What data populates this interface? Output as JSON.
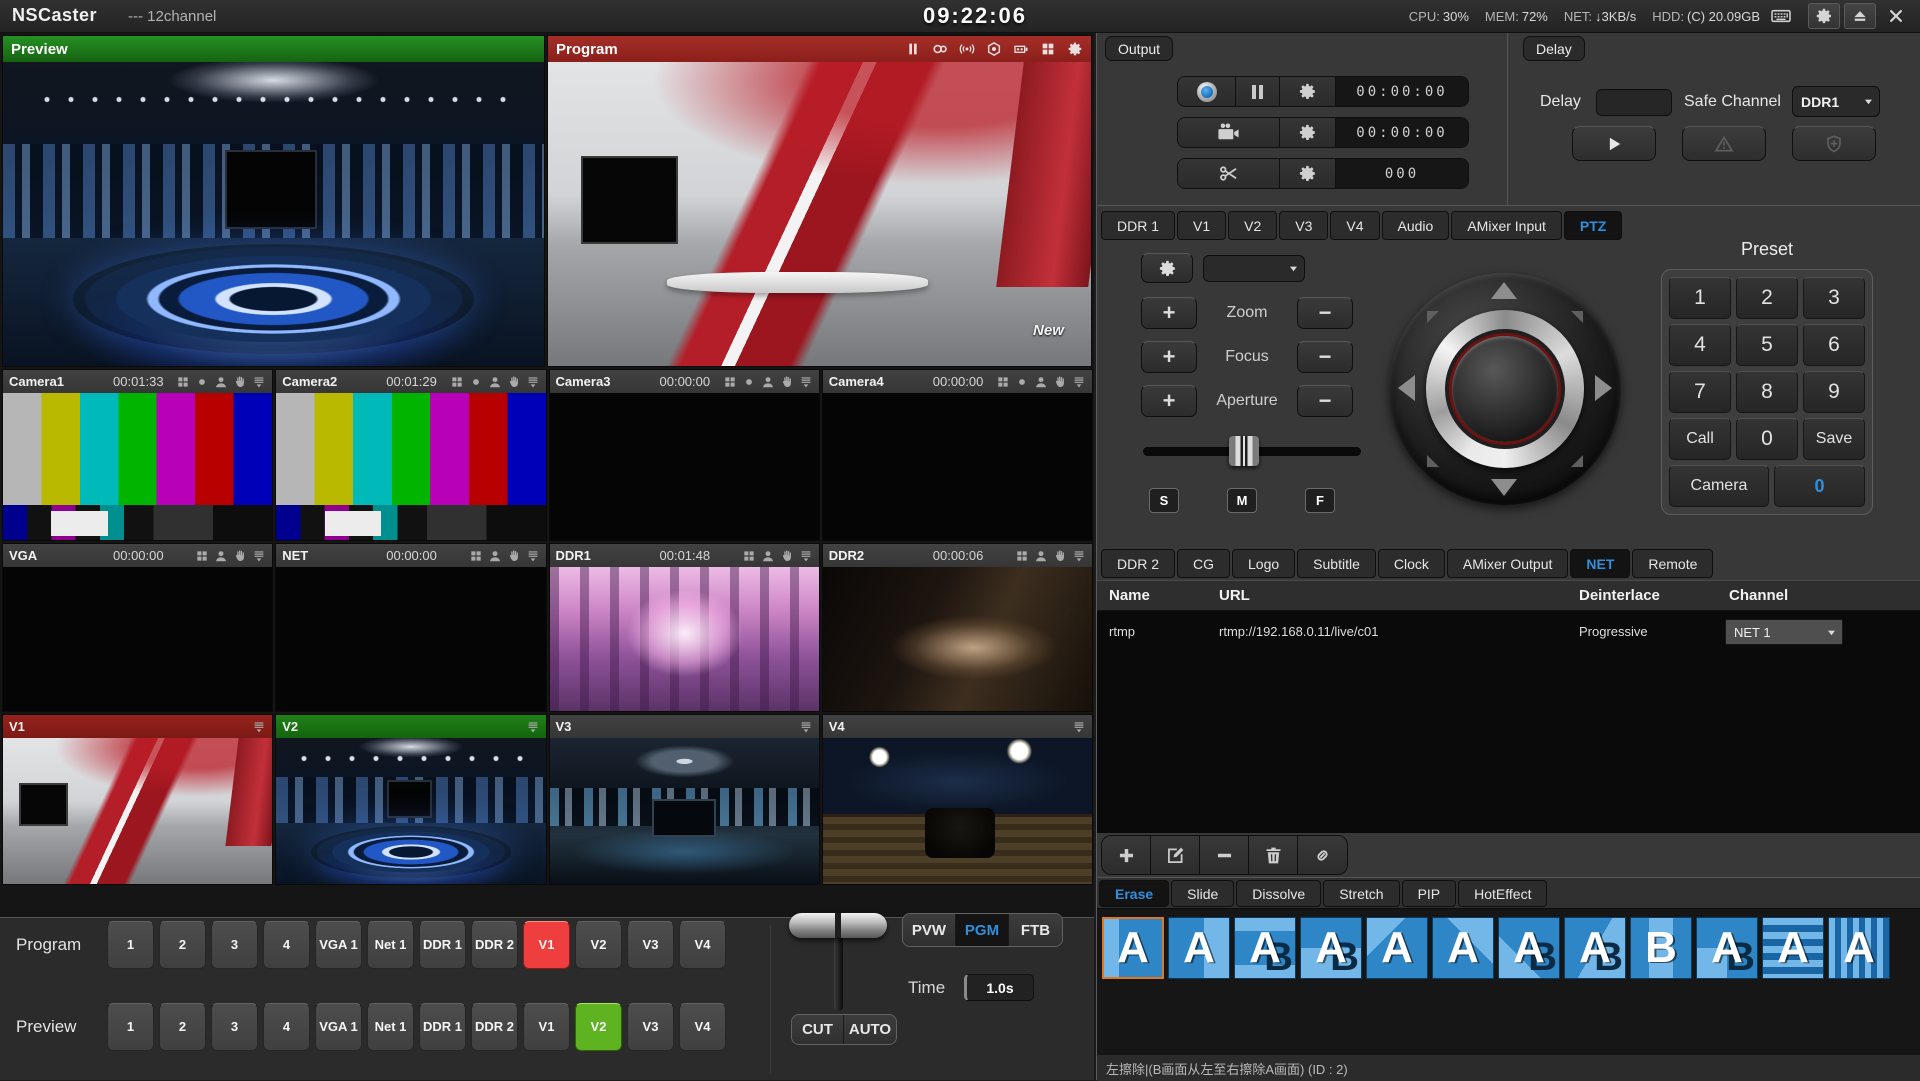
{
  "colors": {
    "accent_blue": "#2f8fde",
    "program_red": "#ee3e3e",
    "preview_green": "#5fb321",
    "tile_blue": "#2e86c6",
    "tile_light": "#72b7e8",
    "tile_selected_border": "#e0761f"
  },
  "titlebar": {
    "app_name": "NSCaster",
    "session": "--- 12channel",
    "clock": "09:22:06",
    "cpu_label": "CPU:",
    "cpu_value": "30%",
    "mem_label": "MEM:",
    "mem_value": "72%",
    "net_label": "NET:",
    "net_value": "↓3KB/s",
    "hdd_label": "HDD:",
    "hdd_value": "(C) 20.09GB",
    "icons": [
      "keyboard-icon",
      "settings-icon",
      "eject-icon",
      "close-icon"
    ]
  },
  "preview_pane": {
    "title": "Preview"
  },
  "program_pane": {
    "title": "Program",
    "watermark": "New",
    "icons": [
      "pause",
      "cc",
      "broadcast",
      "record",
      "capture",
      "grid",
      "gear"
    ]
  },
  "monitors": [
    {
      "name": "Camera1",
      "time": "00:01:33",
      "scene": "colorbars",
      "header": "default",
      "icons": [
        "grid",
        "dot",
        "person",
        "hand",
        "menu"
      ]
    },
    {
      "name": "Camera2",
      "time": "00:01:29",
      "scene": "colorbars",
      "header": "default",
      "icons": [
        "grid",
        "dot",
        "person",
        "hand",
        "menu"
      ]
    },
    {
      "name": "Camera3",
      "time": "00:00:00",
      "scene": "black",
      "header": "default",
      "icons": [
        "grid",
        "dot",
        "person",
        "hand",
        "menu"
      ]
    },
    {
      "name": "Camera4",
      "time": "00:00:00",
      "scene": "black",
      "header": "default",
      "icons": [
        "grid",
        "dot",
        "person",
        "hand",
        "menu"
      ]
    },
    {
      "name": "VGA",
      "time": "00:00:00",
      "scene": "black",
      "header": "default",
      "icons": [
        "grid",
        "person",
        "hand",
        "menu"
      ]
    },
    {
      "name": "NET",
      "time": "00:00:00",
      "scene": "black",
      "header": "default",
      "icons": [
        "grid",
        "person",
        "hand",
        "menu"
      ]
    },
    {
      "name": "DDR1",
      "time": "00:01:48",
      "scene": "forest",
      "header": "default",
      "icons": [
        "grid",
        "person",
        "hand",
        "menu"
      ]
    },
    {
      "name": "DDR2",
      "time": "00:00:06",
      "scene": "hands",
      "header": "default",
      "icons": [
        "grid",
        "person",
        "hand",
        "menu"
      ]
    },
    {
      "name": "V1",
      "time": "",
      "scene": "studio-red",
      "header": "program",
      "icons": [
        "menu"
      ]
    },
    {
      "name": "V2",
      "time": "",
      "scene": "studio-blue",
      "header": "preview",
      "icons": [
        "menu"
      ]
    },
    {
      "name": "V3",
      "time": "",
      "scene": "studio-city",
      "header": "default",
      "icons": [
        "menu"
      ]
    },
    {
      "name": "V4",
      "time": "",
      "scene": "studio-deck",
      "header": "default",
      "icons": [
        "menu"
      ]
    }
  ],
  "switcher": {
    "program_label": "Program",
    "preview_label": "Preview",
    "sources": [
      "1",
      "2",
      "3",
      "4",
      "VGA 1",
      "Net 1",
      "DDR 1",
      "DDR 2",
      "V1",
      "V2",
      "V3",
      "V4"
    ],
    "program_active_index": 8,
    "preview_active_index": 9
  },
  "transport": {
    "pvw": "PVW",
    "pgm": "PGM",
    "ftb": "FTB",
    "active": "PGM",
    "time_label": "Time",
    "time_value": "1.0s",
    "cut": "CUT",
    "auto": "AUTO"
  },
  "output_panel": {
    "title": "Output",
    "record_time": "00:00:00",
    "capture_time": "00:00:00",
    "clip_count": "000"
  },
  "delay_panel": {
    "title": "Delay",
    "delay_label": "Delay",
    "delay_value": "",
    "safe_channel_label": "Safe Channel",
    "safe_channel_value": "DDR1"
  },
  "source_tabs": {
    "items": [
      "DDR 1",
      "V1",
      "V2",
      "V3",
      "V4",
      "Audio",
      "AMixer Input",
      "PTZ"
    ],
    "active": "PTZ"
  },
  "ptz": {
    "rows": [
      {
        "label": "Zoom"
      },
      {
        "label": "Focus"
      },
      {
        "label": "Aperture"
      }
    ],
    "speed_buttons": [
      "S",
      "M",
      "F"
    ],
    "preset_title": "Preset",
    "keypad": [
      "1",
      "2",
      "3",
      "4",
      "5",
      "6",
      "7",
      "8",
      "9",
      "Call",
      "0",
      "Save"
    ],
    "camera_label": "Camera",
    "camera_value": "0"
  },
  "overlay_tabs": {
    "items": [
      "DDR 2",
      "CG",
      "Logo",
      "Subtitle",
      "Clock",
      "AMixer Output",
      "NET",
      "Remote"
    ],
    "active": "NET"
  },
  "net_table": {
    "columns": [
      "Name",
      "URL",
      "Deinterlace",
      "Channel"
    ],
    "rows": [
      {
        "name": "rtmp",
        "url": "rtmp://192.168.0.11/live/c01",
        "deinterlace": "Progressive",
        "channel": "NET 1"
      }
    ]
  },
  "net_toolbar": {
    "buttons": [
      "add",
      "edit",
      "remove",
      "delete",
      "link"
    ]
  },
  "transitions": {
    "tabs": [
      "Erase",
      "Slide",
      "Dissolve",
      "Stretch",
      "PIP",
      "HotEffect"
    ],
    "active": "Erase",
    "selected_index": 0,
    "status": "左擦除|(B画面从左至右擦除A画面) (ID : 2)",
    "effects": [
      {
        "letter": "A",
        "ghost": "",
        "pattern": "wipe-left"
      },
      {
        "letter": "A",
        "ghost": "",
        "pattern": "wipe-right"
      },
      {
        "letter": "A",
        "ghost": "B",
        "pattern": "band-top"
      },
      {
        "letter": "A",
        "ghost": "B",
        "pattern": "split-vert"
      },
      {
        "letter": "A",
        "ghost": "",
        "pattern": "diag-tl"
      },
      {
        "letter": "A",
        "ghost": "",
        "pattern": "diag-tr"
      },
      {
        "letter": "A",
        "ghost": "B",
        "pattern": "diag-br"
      },
      {
        "letter": "A",
        "ghost": "B",
        "pattern": "diag-split"
      },
      {
        "letter": "B",
        "ghost": "",
        "pattern": "band-center"
      },
      {
        "letter": "A",
        "ghost": "B",
        "pattern": "corner"
      },
      {
        "letter": "A",
        "ghost": "",
        "pattern": "stripes-h"
      },
      {
        "letter": "A",
        "ghost": "",
        "pattern": "stripes-v"
      }
    ]
  }
}
